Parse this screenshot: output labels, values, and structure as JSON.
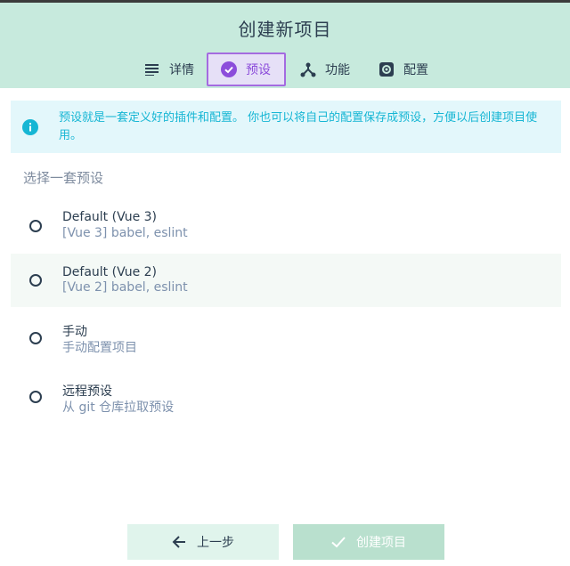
{
  "header": {
    "title": "创建新项目",
    "tabs": [
      {
        "label": "详情",
        "icon": "list-icon",
        "active": false
      },
      {
        "label": "预设",
        "icon": "check-circle-icon",
        "active": true
      },
      {
        "label": "功能",
        "icon": "fork-icon",
        "active": false
      },
      {
        "label": "配置",
        "icon": "gear-icon",
        "active": false
      }
    ]
  },
  "info": {
    "icon": "info-icon",
    "text": "预设就是一套定义好的插件和配置。 你也可以将自己的配置保存成预设，方便以后创建项目使用。"
  },
  "presets": {
    "title": "选择一套预设",
    "items": [
      {
        "name": "Default (Vue 3)",
        "description": "[Vue 3] babel, eslint",
        "selected": false
      },
      {
        "name": "Default (Vue 2)",
        "description": "[Vue 2] babel, eslint",
        "selected": false
      },
      {
        "name": "手动",
        "description": "手动配置项目",
        "selected": false
      },
      {
        "name": "远程预设",
        "description": "从 git 仓库拉取预设",
        "selected": false
      }
    ]
  },
  "footer": {
    "prev_label": "上一步",
    "create_label": "创建项目",
    "create_disabled": true
  },
  "colors": {
    "header_bg": "#c7eadd",
    "accent": "#8c4ddb",
    "info_text": "#16b6d4",
    "info_bg": "#e3f7fb"
  }
}
